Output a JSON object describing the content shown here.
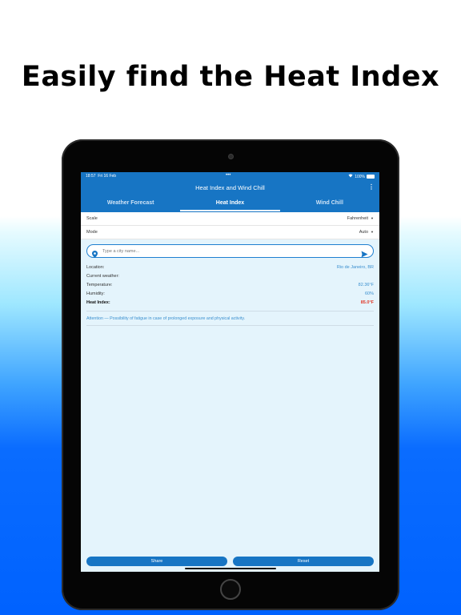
{
  "headline": "Easily find the Heat Index",
  "status": {
    "time": "18:57",
    "date": "Fri 16 Feb",
    "dots": "•••",
    "battery": "100%"
  },
  "app": {
    "title": "Heat Index and Wind Chill"
  },
  "tabs": [
    {
      "label": "Weather Forecast",
      "active": false
    },
    {
      "label": "Heat Index",
      "active": true
    },
    {
      "label": "Wind Chill",
      "active": false
    }
  ],
  "settings": {
    "scale_label": "Scale",
    "scale_value": "Fahrenheit",
    "mode_label": "Mode",
    "mode_value": "Auto"
  },
  "search": {
    "placeholder": "Type a city name..."
  },
  "info": [
    {
      "key": "Location:",
      "value": "Rio de Janeiro, BR"
    },
    {
      "key": "Current weather:",
      "value": ""
    },
    {
      "key": "Temperature:",
      "value": "82.36°F"
    },
    {
      "key": "Humidity:",
      "value": "60%"
    },
    {
      "key": "Heat Index:",
      "value": "85.0°F"
    }
  ],
  "attention": "Attention — Possibility of fatigue in case of prolonged exposure and physical activity.",
  "buttons": {
    "share": "Share",
    "reset": "Reset"
  },
  "colors": {
    "accent": "#1775c4",
    "heat_index": "#e03a2a",
    "value": "#3a8fcf"
  }
}
